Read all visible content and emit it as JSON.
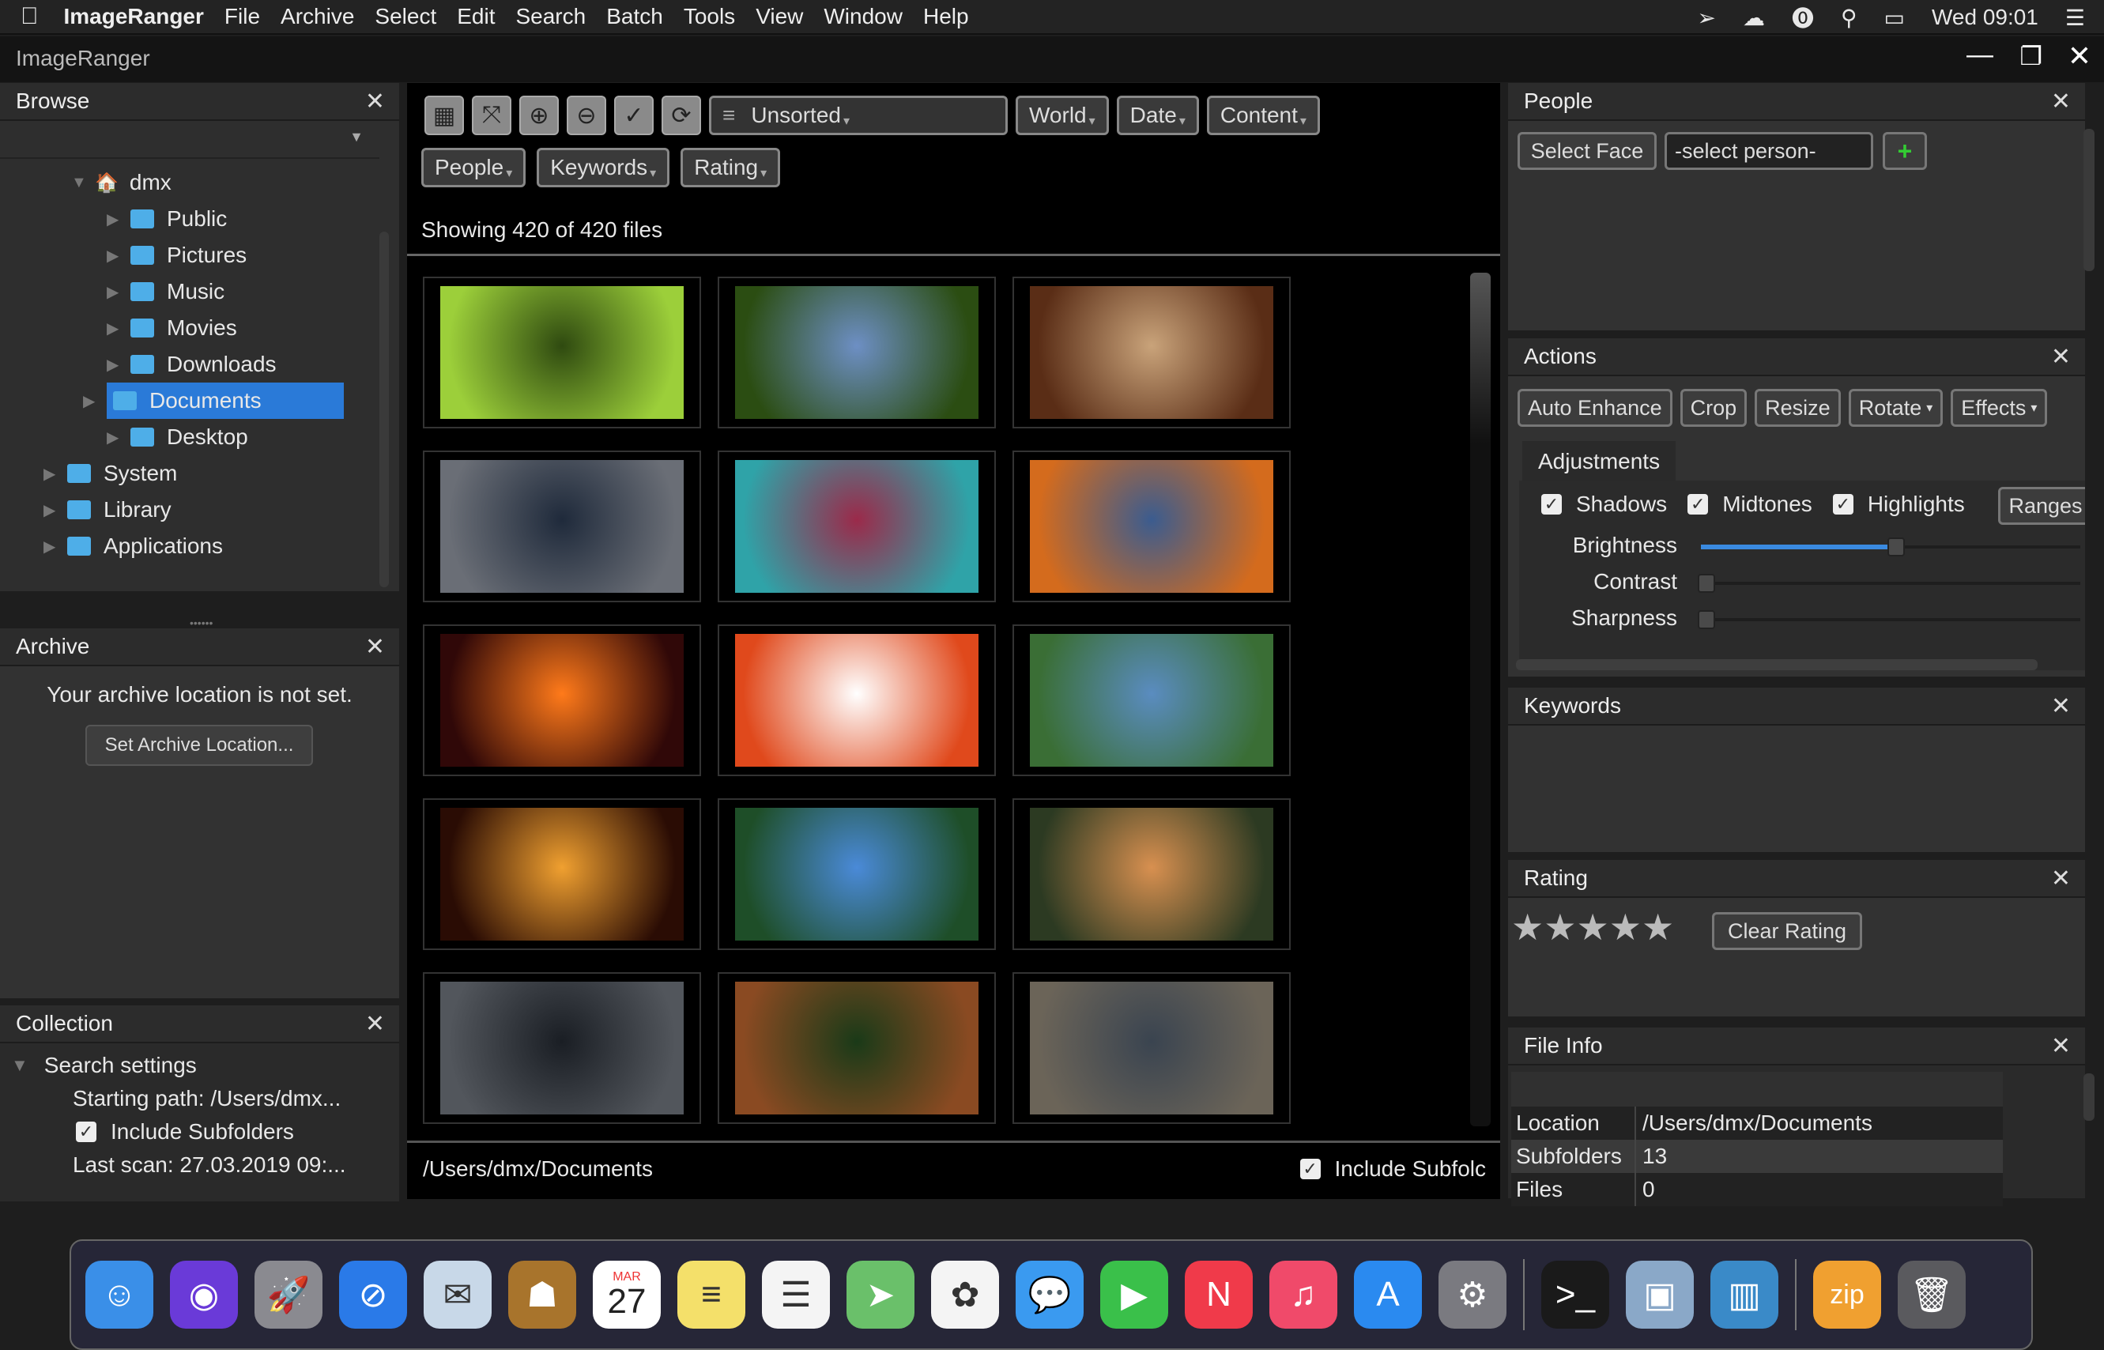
{
  "menubar": {
    "app": "ImageRanger",
    "items": [
      "File",
      "Archive",
      "Select",
      "Edit",
      "Search",
      "Batch",
      "Tools",
      "View",
      "Window",
      "Help"
    ],
    "clock": "Wed 09:01"
  },
  "window": {
    "title": "ImageRanger"
  },
  "browse": {
    "title": "Browse",
    "tree": [
      {
        "label": "dmx",
        "level": 0,
        "icon": "home-icon",
        "expanded": true
      },
      {
        "label": "Public",
        "level": 1
      },
      {
        "label": "Pictures",
        "level": 1
      },
      {
        "label": "Music",
        "level": 1
      },
      {
        "label": "Movies",
        "level": 1
      },
      {
        "label": "Downloads",
        "level": 1
      },
      {
        "label": "Documents",
        "level": 1,
        "selected": true
      },
      {
        "label": "Desktop",
        "level": 1
      },
      {
        "label": "System",
        "level": -1
      },
      {
        "label": "Library",
        "level": -1
      },
      {
        "label": "Applications",
        "level": -1
      }
    ]
  },
  "archive": {
    "title": "Archive",
    "message": "Your archive location is not set.",
    "button": "Set Archive Location..."
  },
  "collection": {
    "title": "Collection",
    "node": "Search settings",
    "starting_path": "Starting path: /Users/dmx...",
    "include_subfolders": "Include Subfolders",
    "last_scan": "Last scan: 27.03.2019 09:..."
  },
  "toolbar": {
    "sort": "Unsorted",
    "filters": [
      "World",
      "Date",
      "Content"
    ],
    "filters2": [
      "People",
      "Keywords",
      "Rating"
    ]
  },
  "grid": {
    "status": "Showing 420 of 420 files",
    "path": "/Users/dmx/Documents",
    "include_subfolders": "Include Subfolc",
    "thumbnails": [
      [
        "#2f4a10",
        "#9ccf3a"
      ],
      [
        "#6d8fc4",
        "#2b4d12"
      ],
      [
        "#c9a37a",
        "#5a2d16"
      ],
      [
        "#1f2a3b",
        "#6a6e76"
      ],
      [
        "#9b2a4a",
        "#2fa3a8"
      ],
      [
        "#3b5c8f",
        "#d46b1d"
      ],
      [
        "#ff7a1a",
        "#300808"
      ],
      [
        "#ffffff",
        "#e0491c"
      ],
      [
        "#5a8cc0",
        "#3a6e35"
      ],
      [
        "#f0a030",
        "#2a0c04"
      ],
      [
        "#4a8ad8",
        "#1e4e28"
      ],
      [
        "#d89050",
        "#2c3a22"
      ],
      [
        "#1a1e24",
        "#52565c"
      ],
      [
        "#1a3a18",
        "#8a4a22"
      ],
      [
        "#3a4450",
        "#6b6458"
      ]
    ]
  },
  "people": {
    "title": "People",
    "select_face": "Select Face",
    "person": "-select person-",
    "add": "+"
  },
  "actions": {
    "title": "Actions",
    "buttons": [
      "Auto Enhance",
      "Crop",
      "Resize"
    ],
    "dropdowns": [
      "Rotate",
      "Effects"
    ],
    "tab": "Adjustments",
    "checks": [
      "Shadows",
      "Midtones",
      "Highlights"
    ],
    "ranges": "Ranges",
    "sliders": [
      {
        "label": "Brightness",
        "value": 0.5
      },
      {
        "label": "Contrast",
        "value": 0
      },
      {
        "label": "Sharpness",
        "value": 0
      }
    ]
  },
  "keywords": {
    "title": "Keywords"
  },
  "rating": {
    "title": "Rating",
    "stars": 0,
    "max": 5,
    "clear": "Clear Rating"
  },
  "fileinfo": {
    "title": "File Info",
    "rows": [
      {
        "k": "Location",
        "v": "/Users/dmx/Documents"
      },
      {
        "k": "Subfolders",
        "v": "13"
      },
      {
        "k": "Files",
        "v": "0"
      }
    ]
  },
  "dock": {
    "calendar_month": "MAR",
    "calendar_day": "27",
    "zip": "zip",
    "apps": [
      {
        "icon": "finder-icon",
        "color": "#3a8fe8",
        "glyph": "☺"
      },
      {
        "icon": "siri-icon",
        "color": "#6a3ad8",
        "glyph": "◉"
      },
      {
        "icon": "launchpad-icon",
        "color": "#8a8a90",
        "glyph": "🚀"
      },
      {
        "icon": "safari-icon",
        "color": "#2a7ae8",
        "glyph": "⊘"
      },
      {
        "icon": "mail-icon",
        "color": "#c8d8e8",
        "glyph": "✉"
      },
      {
        "icon": "contacts-icon",
        "color": "#a8742c",
        "glyph": "☗"
      },
      {
        "icon": "calendar-icon",
        "color": "#ffffff",
        "glyph": ""
      },
      {
        "icon": "notes-icon",
        "color": "#f4e06a",
        "glyph": "≡"
      },
      {
        "icon": "reminders-icon",
        "color": "#f4f4f4",
        "glyph": "☰"
      },
      {
        "icon": "maps-icon",
        "color": "#6ac06a",
        "glyph": "➤"
      },
      {
        "icon": "photos-icon",
        "color": "#f4f4f4",
        "glyph": "✿"
      },
      {
        "icon": "messages-icon",
        "color": "#3a9af0",
        "glyph": "💬"
      },
      {
        "icon": "facetime-icon",
        "color": "#3ac04a",
        "glyph": "▶"
      },
      {
        "icon": "news-icon",
        "color": "#f03a4a",
        "glyph": "N"
      },
      {
        "icon": "music-icon",
        "color": "#f04a6a",
        "glyph": "♫"
      },
      {
        "icon": "appstore-icon",
        "color": "#2a8af0",
        "glyph": "A"
      },
      {
        "icon": "system-preferences-icon",
        "color": "#7a7a80",
        "glyph": "⚙"
      },
      {
        "icon": "terminal-icon",
        "color": "#1a1a1a",
        "glyph": ">_"
      },
      {
        "icon": "preview-icon",
        "color": "#8aa8c8",
        "glyph": "▣"
      },
      {
        "icon": "imageranger-icon",
        "color": "#3a8ac8",
        "glyph": "▥"
      },
      {
        "icon": "archive-utility-icon",
        "color": "#f0a030",
        "glyph": ""
      },
      {
        "icon": "trash-icon",
        "color": "#5a5a5e",
        "glyph": "🗑"
      }
    ]
  }
}
